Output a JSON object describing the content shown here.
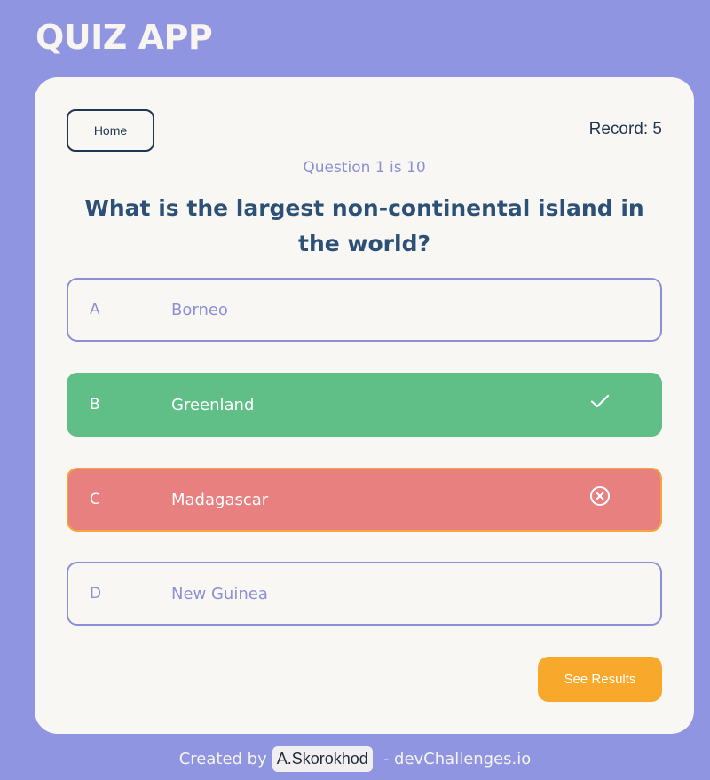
{
  "app": {
    "title": "QUIZ APP"
  },
  "toolbar": {
    "home_label": "Home",
    "record_label": "Record: 5"
  },
  "question": {
    "counter": "Question 1 is 10",
    "text": "What is the largest non-continental island in the world?"
  },
  "options": [
    {
      "letter": "A",
      "text": "Borneo",
      "state": "default"
    },
    {
      "letter": "B",
      "text": "Greenland",
      "state": "correct",
      "icon": "check-icon"
    },
    {
      "letter": "C",
      "text": "Madagascar",
      "state": "wrong",
      "icon": "x-circle-icon"
    },
    {
      "letter": "D",
      "text": "New Guinea",
      "state": "default"
    }
  ],
  "actions": {
    "results_label": "See Results"
  },
  "footer": {
    "prefix": "Created by",
    "author": "A.Skorokhod",
    "suffix": "- devChallenges.io"
  },
  "colors": {
    "background": "#8f95e0",
    "card": "#f9f7f4",
    "correct": "#5fbf86",
    "wrong": "#e98080",
    "accent": "#f8a92b",
    "text_dark": "#2c5076",
    "text_muted": "#8b90d6"
  }
}
